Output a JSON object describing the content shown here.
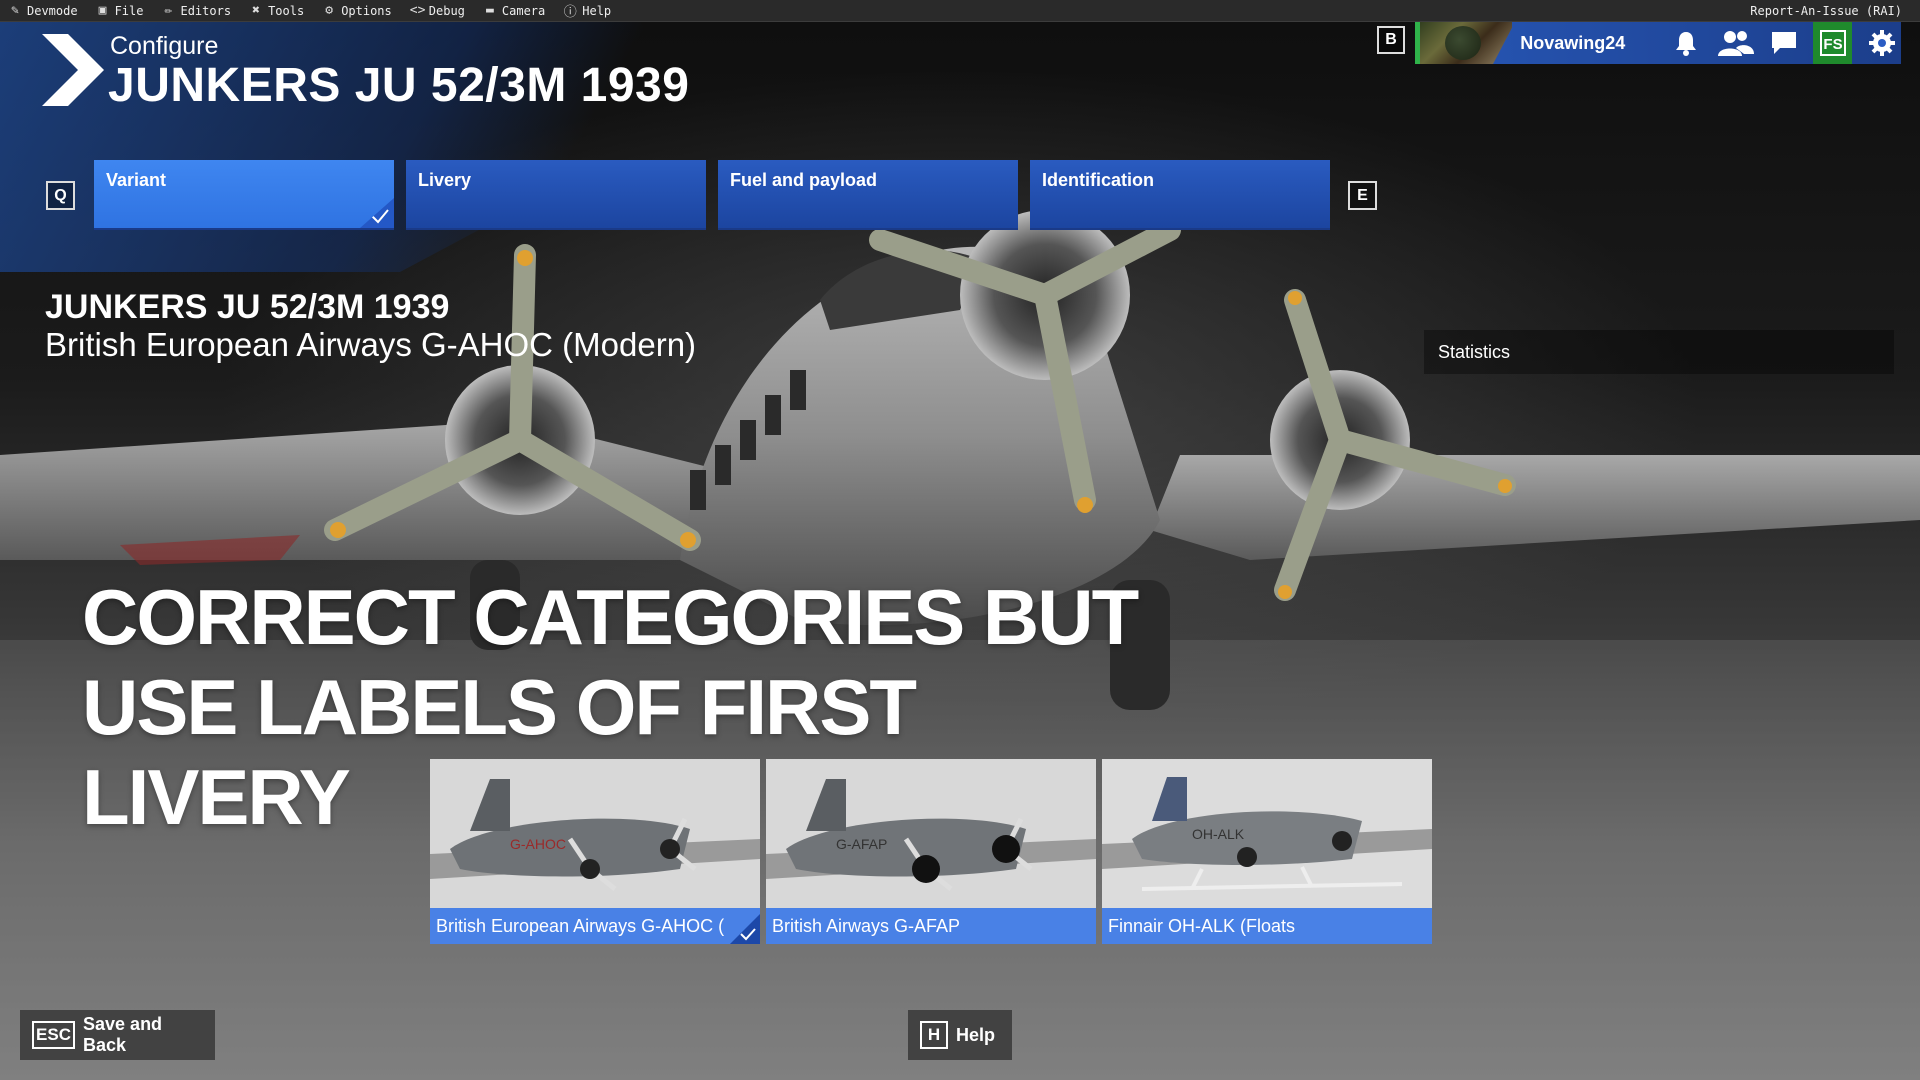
{
  "devbar": {
    "items": [
      {
        "label": "Devmode",
        "icon": "devmode-icon"
      },
      {
        "label": "File",
        "icon": "folder-icon"
      },
      {
        "label": "Editors",
        "icon": "pencil-icon"
      },
      {
        "label": "Tools",
        "icon": "tools-icon"
      },
      {
        "label": "Options",
        "icon": "gear-icon"
      },
      {
        "label": "Debug",
        "icon": "code-icon"
      },
      {
        "label": "Camera",
        "icon": "camera-icon"
      },
      {
        "label": "Help",
        "icon": "help-icon"
      }
    ],
    "right_label": "Report-An-Issue (RAI)"
  },
  "header": {
    "section": "Configure",
    "title": "JUNKERS JU 52/3M 1939"
  },
  "userbar": {
    "key_hint": "B",
    "username": "Novawing24",
    "icons": [
      "bell-icon",
      "friends-icon",
      "chat-icon",
      "fs-icon",
      "settings-gear-icon"
    ],
    "accent": "#2a5cc4",
    "fs_accent": "#1f8a2c"
  },
  "tabs": {
    "prev_key": "Q",
    "next_key": "E",
    "items": [
      {
        "label": "Variant",
        "active": true
      },
      {
        "label": "Livery",
        "active": false
      },
      {
        "label": "Fuel and payload",
        "active": false
      },
      {
        "label": "Identification",
        "active": false
      }
    ]
  },
  "info": {
    "title": "JUNKERS JU 52/3M 1939",
    "subtitle": "British European Airways G-AHOC (Modern)"
  },
  "stats": {
    "label": "Statistics"
  },
  "overlay": {
    "line1": "CORRECT CATEGORIES BUT",
    "line2": "USE LABELS OF FIRST LIVERY"
  },
  "liveries": [
    {
      "label": "British European Airways G-AHOC (",
      "reg": "G-AHOC",
      "selected": true
    },
    {
      "label": "British Airways G-AFAP",
      "reg": "G-AFAP",
      "selected": false
    },
    {
      "label": "Finnair OH-ALK (Floats",
      "reg": "OH-ALK",
      "selected": false
    }
  ],
  "buttons": {
    "back": {
      "key": "ESC",
      "label": "Save and Back"
    },
    "help": {
      "key": "H",
      "label": "Help"
    }
  }
}
